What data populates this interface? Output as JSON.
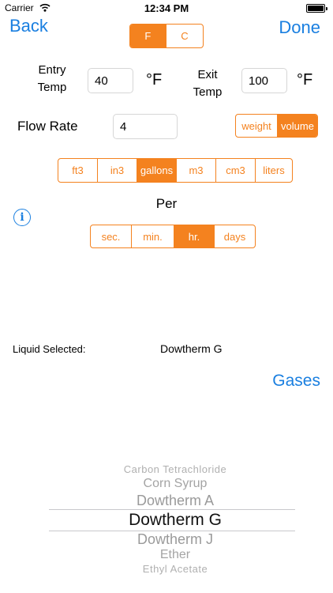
{
  "status_bar": {
    "carrier": "Carrier",
    "time": "12:34 PM"
  },
  "nav": {
    "back": "Back",
    "done": "Done"
  },
  "temp_unit": {
    "options": [
      "F",
      "C"
    ],
    "selected": "F"
  },
  "entry": {
    "label_line1": "Entry",
    "label_line2": "Temp",
    "value": "40",
    "unit": "°F"
  },
  "exit": {
    "label_line1": "Exit",
    "label_line2": "Temp",
    "value": "100",
    "unit": "°F"
  },
  "flow": {
    "label": "Flow Rate",
    "value": "4",
    "mode_options": [
      "weight",
      "volume"
    ],
    "mode_selected": "volume"
  },
  "volume_units": {
    "options": [
      "ft3",
      "in3",
      "gallons",
      "m3",
      "cm3",
      "liters"
    ],
    "selected": "gallons"
  },
  "per": {
    "label": "Per",
    "options": [
      "sec.",
      "min.",
      "hr.",
      "days"
    ],
    "selected": "hr."
  },
  "liquid": {
    "label": "Liquid Selected:",
    "value": "Dowtherm G"
  },
  "gases_button": "Gases",
  "picker": {
    "items": [
      "Carbon Tetrachloride",
      "Corn Syrup",
      "Dowtherm A",
      "Dowtherm G",
      "Dowtherm J",
      "Ether",
      "Ethyl Acetate"
    ],
    "selected": "Dowtherm G"
  },
  "colors": {
    "accent": "#f4821f",
    "link": "#1a7fe0"
  },
  "icons": {
    "info": "info-icon",
    "wifi": "wifi-icon",
    "battery": "battery-icon"
  }
}
